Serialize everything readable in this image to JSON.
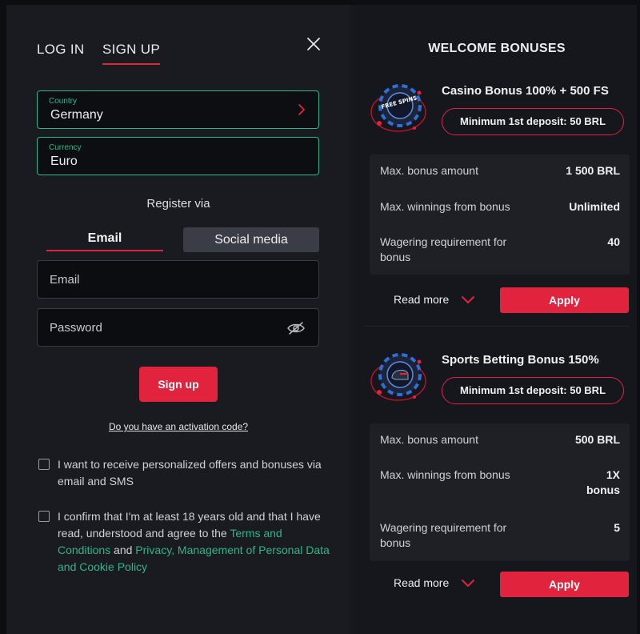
{
  "auth_tabs": {
    "login": "LOG IN",
    "signup": "SIGN UP"
  },
  "country": {
    "label": "Country",
    "value": "Germany"
  },
  "currency": {
    "label": "Currency",
    "value": "Euro"
  },
  "register_via": "Register via",
  "method_tabs": {
    "email": "Email",
    "social": "Social media"
  },
  "email_input": {
    "placeholder": "Email"
  },
  "password_input": {
    "placeholder": "Password"
  },
  "signup_button": "Sign up",
  "activation_link": "Do you have an activation code?",
  "checkbox_offers": "I want to receive personalized offers and bonuses via email and SMS",
  "checkbox_age": {
    "text_before": "I confirm that I'm at least 18 years old and that I have read, understood and agree to the ",
    "link_terms": "Terms and Conditions",
    "and": " and ",
    "link_privacy": "Privacy, Management of Personal Data and Cookie Policy"
  },
  "welcome_title": "WELCOME BONUSES",
  "bonuses": [
    {
      "name": "Casino Bonus 100% + 500 FS",
      "icon": "free-spins-chip-icon",
      "icon_text": "FREE SPINS",
      "min_deposit": "Minimum 1st deposit: 50 BRL",
      "stats": [
        {
          "k": "Max. bonus amount",
          "v": "1 500 BRL"
        },
        {
          "k": "Max. winnings from bonus",
          "v": "Unlimited"
        },
        {
          "k": "Wagering requirement for bonus",
          "v": "40"
        }
      ],
      "read_more": "Read more",
      "apply": "Apply"
    },
    {
      "name": "Sports Betting Bonus 150%",
      "icon": "sports-chip-icon",
      "min_deposit": "Minimum 1st deposit: 50 BRL",
      "stats": [
        {
          "k": "Max. bonus amount",
          "v": "500 BRL"
        },
        {
          "k": "Max. winnings from bonus",
          "v": "1X bonus"
        },
        {
          "k": "Wagering requirement for bonus",
          "v": "5"
        }
      ],
      "read_more": "Read more",
      "apply": "Apply"
    }
  ],
  "colors": {
    "accent": "#e2233d",
    "green": "#2fb587",
    "bg": "#1a1b20"
  }
}
